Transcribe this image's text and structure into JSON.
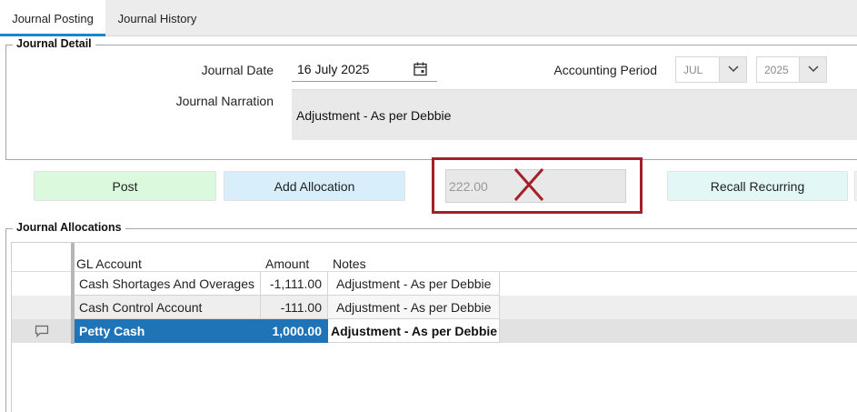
{
  "tabs": [
    {
      "label": "Journal Posting",
      "active": true
    },
    {
      "label": "Journal History",
      "active": false
    }
  ],
  "journal_detail": {
    "group_title": "Journal Detail",
    "date_label": "Journal Date",
    "date_value": "16 July 2025",
    "narration_label": "Journal Narration",
    "narration_value": "Adjustment - As per Debbie",
    "period_label": "Accounting Period",
    "period_month": "JUL",
    "period_year": "2025"
  },
  "actions": {
    "post_label": "Post",
    "add_allocation_label": "Add Allocation",
    "total_value": "222.00",
    "recall_label": "Recall Recurring"
  },
  "allocations": {
    "group_title": "Journal Allocations",
    "columns": {
      "account": "GL Account",
      "amount": "Amount",
      "notes": "Notes"
    },
    "rows": [
      {
        "account": "Cash Shortages And Overages",
        "amount": "-1,111.00",
        "notes": "Adjustment - As per Debbie"
      },
      {
        "account": "Cash Control Account",
        "amount": "-111.00",
        "notes": "Adjustment - As per Debbie"
      },
      {
        "account": "Petty Cash",
        "amount": "1,000.00",
        "notes": "Adjustment - As per Debbie",
        "selected": true
      }
    ]
  },
  "colors": {
    "tab_accent": "#1b86c6",
    "post_button": "#dbf9dd",
    "allocation_button": "#d8eefb",
    "recall_button": "#e3f7f6",
    "selected_row": "#1f74b8",
    "annotation_red": "#a3202a"
  },
  "icons": [
    "calendar-icon",
    "chevron-down-icon",
    "close-x-icon",
    "comment-icon"
  ]
}
